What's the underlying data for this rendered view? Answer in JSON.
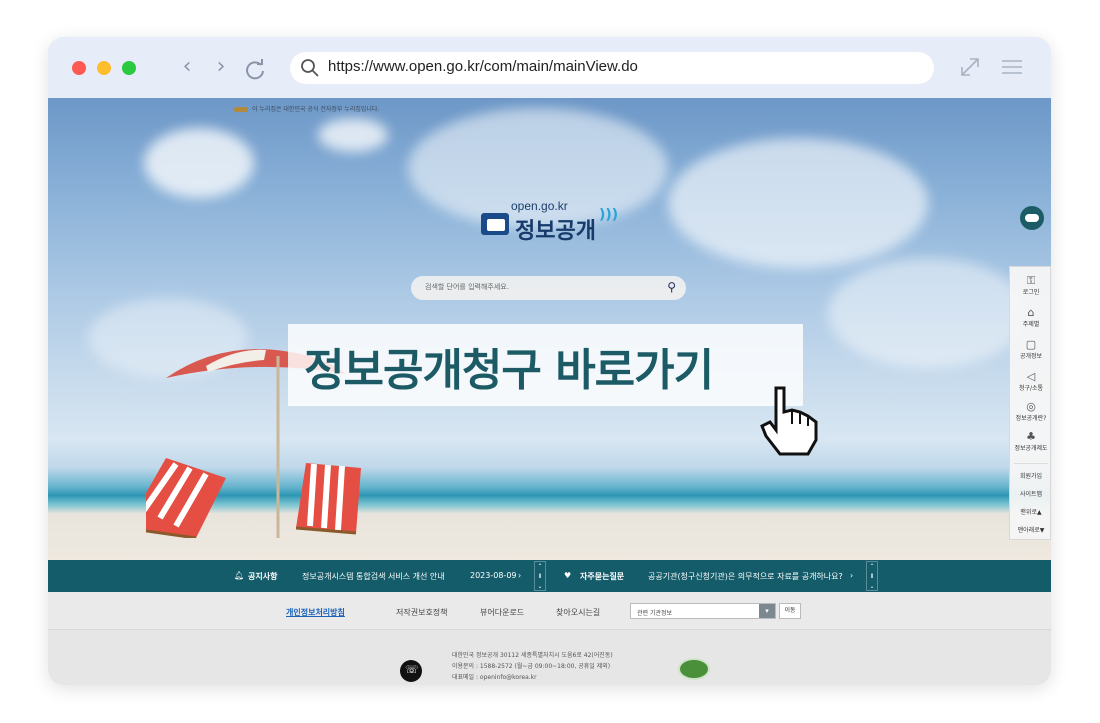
{
  "browser": {
    "url": "https://www.open.go.kr/com/main/mainView.do",
    "nav": {
      "back": "‹",
      "forward": "›"
    }
  },
  "site": {
    "gov_notice": "이 누리집은 대한민국 공식 전자정부 누리집입니다.",
    "logo_domain": "open.go.kr",
    "logo_title": "정보공개",
    "search_placeholder": "검색할 단어를 입력해주세요.",
    "banner_text": "정보공개청구 바로가기"
  },
  "sidebar": {
    "items": [
      {
        "icon": "lock-icon",
        "glyph": "⚿",
        "label": "로그인"
      },
      {
        "icon": "bank-icon",
        "glyph": "⌂",
        "label": "주제별"
      },
      {
        "icon": "document-icon",
        "glyph": "▢",
        "label": "공개정보"
      },
      {
        "icon": "megaphone-icon",
        "glyph": "◁",
        "label": "청구/소통"
      },
      {
        "icon": "target-icon",
        "glyph": "◎",
        "label": "정보공개란?"
      },
      {
        "icon": "people-icon",
        "glyph": "♣",
        "label": "정보공개제도"
      }
    ],
    "links": [
      "회원가입",
      "사이트맵",
      "맨위로▲",
      "맨아래로▼"
    ]
  },
  "notice": {
    "label": "공지사항",
    "text": "정보공개시스템 통합검색 서비스 개선 안내",
    "date": "2023-08-09",
    "faq_label": "자주묻는질문",
    "faq_text": "공공기관(청구신청기관)은 의무적으로 자료를 공개하나요?"
  },
  "footer": {
    "links": [
      "개인정보처리방침",
      "저작권보호정책",
      "뷰어다운로드",
      "찾아오시는길"
    ],
    "select_value": "관련 기관정보",
    "go_label": "이동",
    "address": "대한민국 정보공개 30112 세종특별자치시 도움6로 42(어진동)",
    "phone": "이용문의 : 1588-2572 (월~금 09:00~18:00, 공휴일 제외)",
    "email": "대표메일 : openinfo@korea.kr"
  }
}
